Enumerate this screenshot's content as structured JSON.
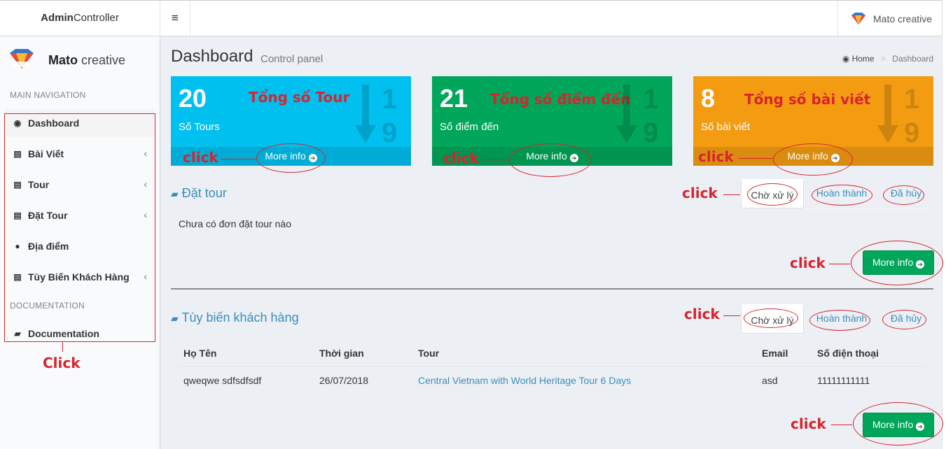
{
  "topbar": {
    "brand_bold": "Admin",
    "brand_rest": "Controller",
    "toggle_icon": "≡",
    "user_name": "Mato creative"
  },
  "sidebar": {
    "brand_bold": "Mato",
    "brand_rest": " creative",
    "header_main": "MAIN NAVIGATION",
    "header_doc": "DOCUMENTATION",
    "items": [
      {
        "label": "Dashboard",
        "icon": "dashboard-icon",
        "glyph": "◉"
      },
      {
        "label": "Bài Viết",
        "icon": "newspaper-icon",
        "glyph": "▤",
        "chevron": "‹"
      },
      {
        "label": "Tour",
        "icon": "newspaper-icon",
        "glyph": "▤",
        "chevron": "‹"
      },
      {
        "label": "Đặt Tour",
        "icon": "newspaper-icon",
        "glyph": "▤",
        "chevron": "‹"
      },
      {
        "label": "Địa điểm",
        "icon": "globe-icon",
        "glyph": "●"
      },
      {
        "label": "Tùy Biến Khách Hàng",
        "icon": "newspaper-icon",
        "glyph": "▤",
        "chevron": "‹"
      },
      {
        "label": "Documentation",
        "icon": "book-icon",
        "glyph": "▰"
      }
    ],
    "annotation": "Click"
  },
  "header": {
    "title": "Dashboard",
    "subtitle": "Control panel",
    "breadcrumb_home": "Home",
    "breadcrumb_sep": ">",
    "breadcrumb_current": "Dashboard"
  },
  "boxes": [
    {
      "number": "20",
      "label": "Số Tours",
      "title": "Tổng số Tour",
      "footer": "More info",
      "annotation": "click",
      "color": "#00c0ef"
    },
    {
      "number": "21",
      "label": "Số điểm đến",
      "title": "Tổng số điểm đến",
      "footer": "More info",
      "annotation": "click",
      "color": "#00a65a"
    },
    {
      "number": "8",
      "label": "Số bài viết",
      "title": "Tổng số bài viết",
      "footer": "More info",
      "annotation": "click",
      "color": "#f39c12"
    }
  ],
  "dat_tour": {
    "title": "Đặt tour",
    "tabs": [
      "Chờ xử lý",
      "Hoàn thành",
      "Đã hủy"
    ],
    "empty_message": "Chưa có đơn đặt tour nào",
    "button": "More info",
    "annotation_tabs": "click",
    "annotation_button": "click"
  },
  "tuy_bien": {
    "title": "Tùy biến khách hàng",
    "tabs": [
      "Chờ xử lý",
      "Hoàn thành",
      "Đã hủy"
    ],
    "columns": [
      "Họ Tên",
      "Thời gian",
      "Tour",
      "Email",
      "Số điện thoại"
    ],
    "rows": [
      [
        "qweqwe sdfsdfsdf",
        "26/07/2018",
        "Central Vietnam with World Heritage Tour 6 Days",
        "asd",
        "11111111111"
      ]
    ],
    "button": "More info",
    "annotation_tabs": "click",
    "annotation_button": "click"
  },
  "colors": {
    "aqua": "#00c0ef",
    "green": "#00a65a",
    "yellow": "#f39c12",
    "link": "#3c8dbc",
    "annotation_red": "#d9232d"
  },
  "deco": {
    "one": "1",
    "nine": "9",
    "down_arrow": "↓",
    "circle_arrow": "➔"
  }
}
